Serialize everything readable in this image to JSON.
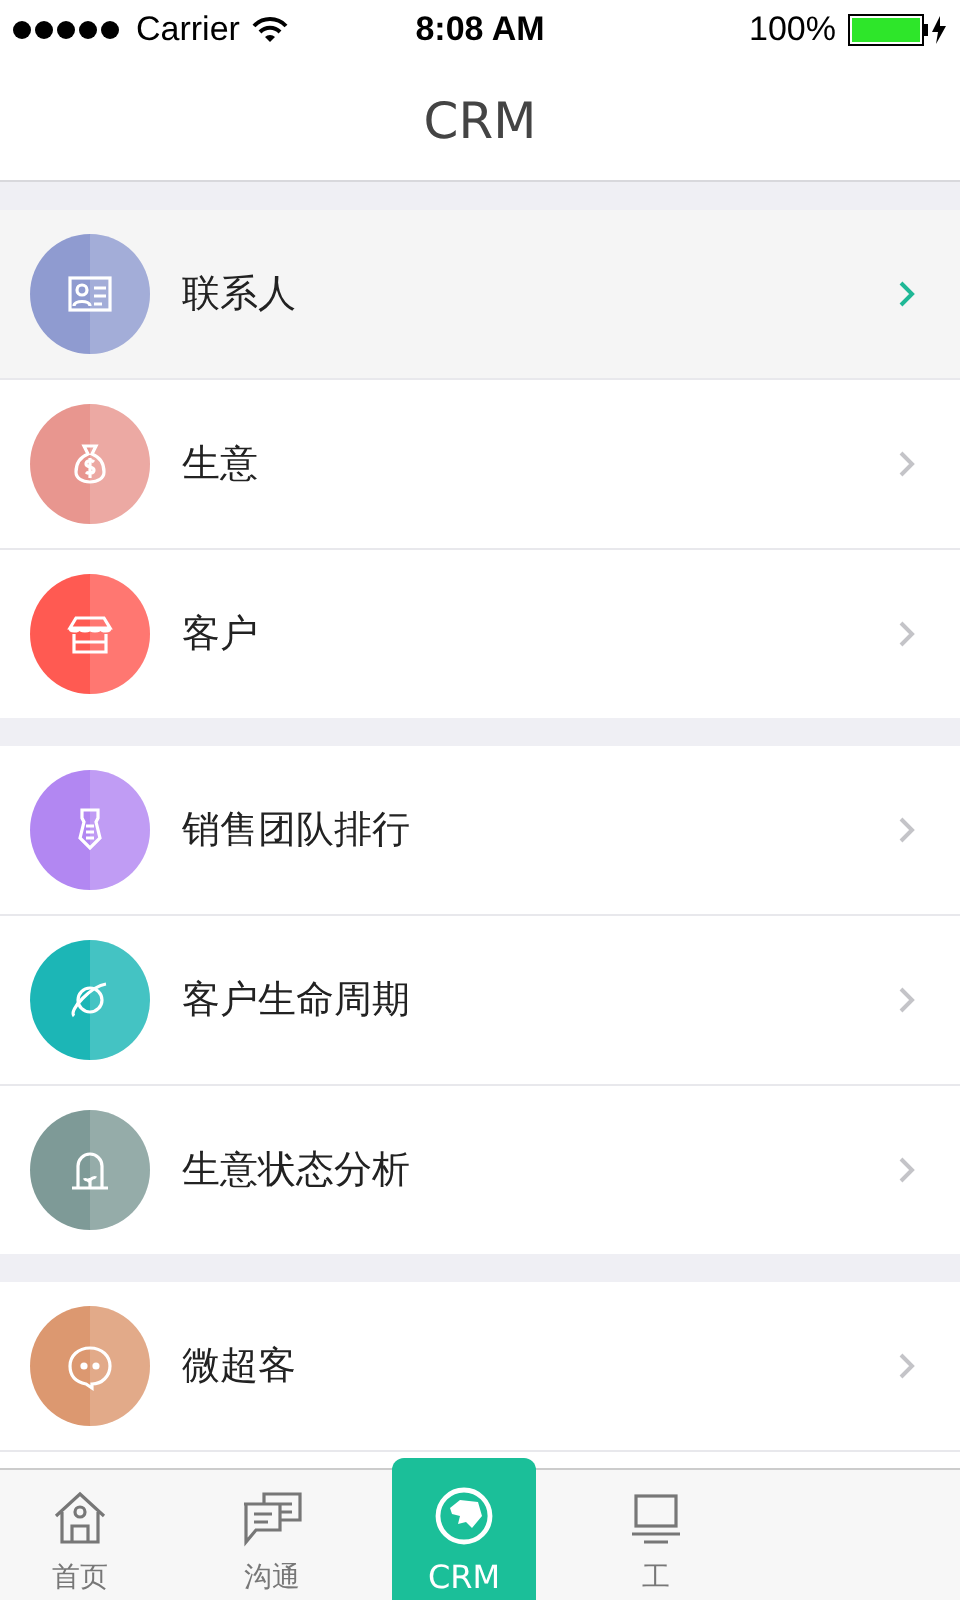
{
  "status_bar": {
    "carrier": "Carrier",
    "time": "8:08 AM",
    "battery": "100%"
  },
  "nav": {
    "title": "CRM"
  },
  "groups": [
    {
      "items": [
        {
          "label": "联系人",
          "color": "#8f9bd0",
          "selected": true
        },
        {
          "label": "生意",
          "color": "#e8968f",
          "selected": false
        },
        {
          "label": "客户",
          "color": "#ff5a52",
          "selected": false
        }
      ]
    },
    {
      "items": [
        {
          "label": "销售团队排行",
          "color": "#b287f2",
          "selected": false
        },
        {
          "label": "客户生命周期",
          "color": "#1cb6b6",
          "selected": false
        },
        {
          "label": "生意状态分析",
          "color": "#7e9a97",
          "selected": false
        }
      ]
    },
    {
      "items": [
        {
          "label": "微超客",
          "color": "#dc9870",
          "selected": false
        }
      ]
    }
  ],
  "tabs": [
    {
      "label": "首页",
      "selected": false
    },
    {
      "label": "沟通",
      "selected": false
    },
    {
      "label": "CRM",
      "selected": true
    },
    {
      "label": "工",
      "selected": false
    }
  ]
}
